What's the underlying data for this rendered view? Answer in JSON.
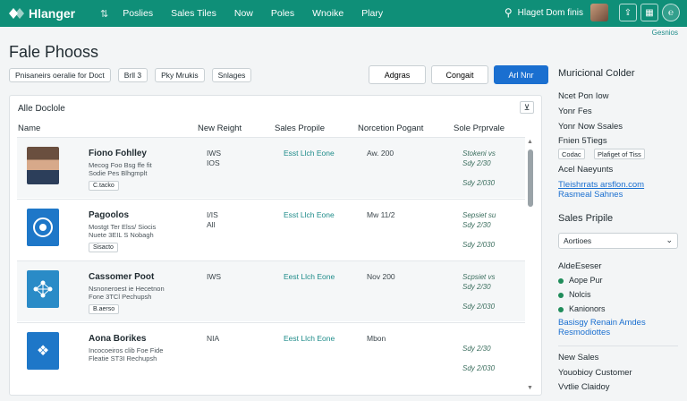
{
  "topbar": {
    "app_name": "Hlanger",
    "nav_icon": "⇅",
    "nav": [
      "Poslies",
      "Sales Tiles",
      "Now",
      "Poles",
      "Wnoike",
      "Plary"
    ],
    "user_name": "Hlaget Dom finis",
    "icons": [
      "user-icon",
      "avatar",
      "upload-icon",
      "chart-icon",
      "help-icon"
    ],
    "accent": "#0f8f78"
  },
  "top_link": "Gesnios",
  "page_title": "Fale Phooss",
  "filters": [
    "Pnisaneirs oeralie for Doct",
    "Brll 3",
    "Pky Mrukis",
    "Snlages"
  ],
  "actions": {
    "a": "Adgras",
    "b": "Congait",
    "primary": "Arl Nnr",
    "primary_color": "#1a6fd0"
  },
  "panel": {
    "title": "Alle Doclole",
    "menu_glyph": "⊻",
    "columns": [
      "Name",
      "New Reight",
      "Sales Propile",
      "Norcetion Pogant",
      "Sole Prprvale"
    ],
    "rows": [
      {
        "name": "Fiono Fohlley",
        "desc": [
          "Mecog Foo Bsg ffe fit",
          "Sodie Pes Blhgmplt"
        ],
        "tag": "C.tacko",
        "c2": [
          "IWS",
          "IOS"
        ],
        "link": "Esst Llch Eone",
        "c4": "Aw. 200",
        "c5": [
          "Stokeni vs",
          "Sdy 2/30",
          "",
          "Sdy 2/030"
        ],
        "thumb": "photo"
      },
      {
        "name": "Pagoolos",
        "desc": [
          "Mostgt Ter Elss/ Siocis",
          "Nuete 3EIL S Nobagh"
        ],
        "tag": "Sisacto",
        "c2": [
          "I/IS",
          "All"
        ],
        "link": "Esst Llch Eone",
        "c4": "Mw 11/2",
        "c5": [
          "Sepsiet su",
          "Sdy 2/30",
          "",
          "Sdy 2/030"
        ],
        "thumb": "blue"
      },
      {
        "name": "Cassomer Poot",
        "desc": [
          "Nsnoneroest ie Hecetnon",
          "Fone 3TCl Pechupsh"
        ],
        "tag": "B.aerso",
        "c2": [
          "IWS"
        ],
        "link": "Eest Llch Eone",
        "c4": "Nov 200",
        "c5": [
          "Scpsiet vs",
          "Sdy 2/30",
          "",
          "Sdy 2/030"
        ],
        "thumb": "blue2"
      },
      {
        "name": "Aona Borikes",
        "desc": [
          "Incocoeiros clib Foe Fide",
          "Fleatie ST3I Rechupsh"
        ],
        "tag": "",
        "c2": [
          "NIA"
        ],
        "link": "Eest Llch Eone",
        "c4": "Mbon",
        "c5": [
          "",
          "Sdy 2/30",
          "",
          "Sdy 2/030"
        ],
        "thumb": "blue"
      }
    ]
  },
  "sidebar": {
    "title": "Muricional Colder",
    "items": [
      "Ncet Pon Iow",
      "Yonr Fes",
      "Yonr Now Ssales",
      "Fnien 5Tiegs"
    ],
    "pills": [
      "Codac",
      "Plafiget of Tiss"
    ],
    "section2": "Acel Naeyunts",
    "links": [
      "Tleishrrats arsflon.com",
      "Rasmeal Sahnes"
    ],
    "section3": "Sales Pripile",
    "select_value": "Aortioes",
    "section4": "AldeEseser",
    "dots": [
      "Aope Pur",
      "Nolcis",
      "Kanionors"
    ],
    "links2": [
      "Basisgy Renain Amdes",
      "Resmodiottes"
    ],
    "section5": "New Sales",
    "items2": [
      "Youobioy Customer",
      "Vvtlie Claidoy"
    ]
  }
}
